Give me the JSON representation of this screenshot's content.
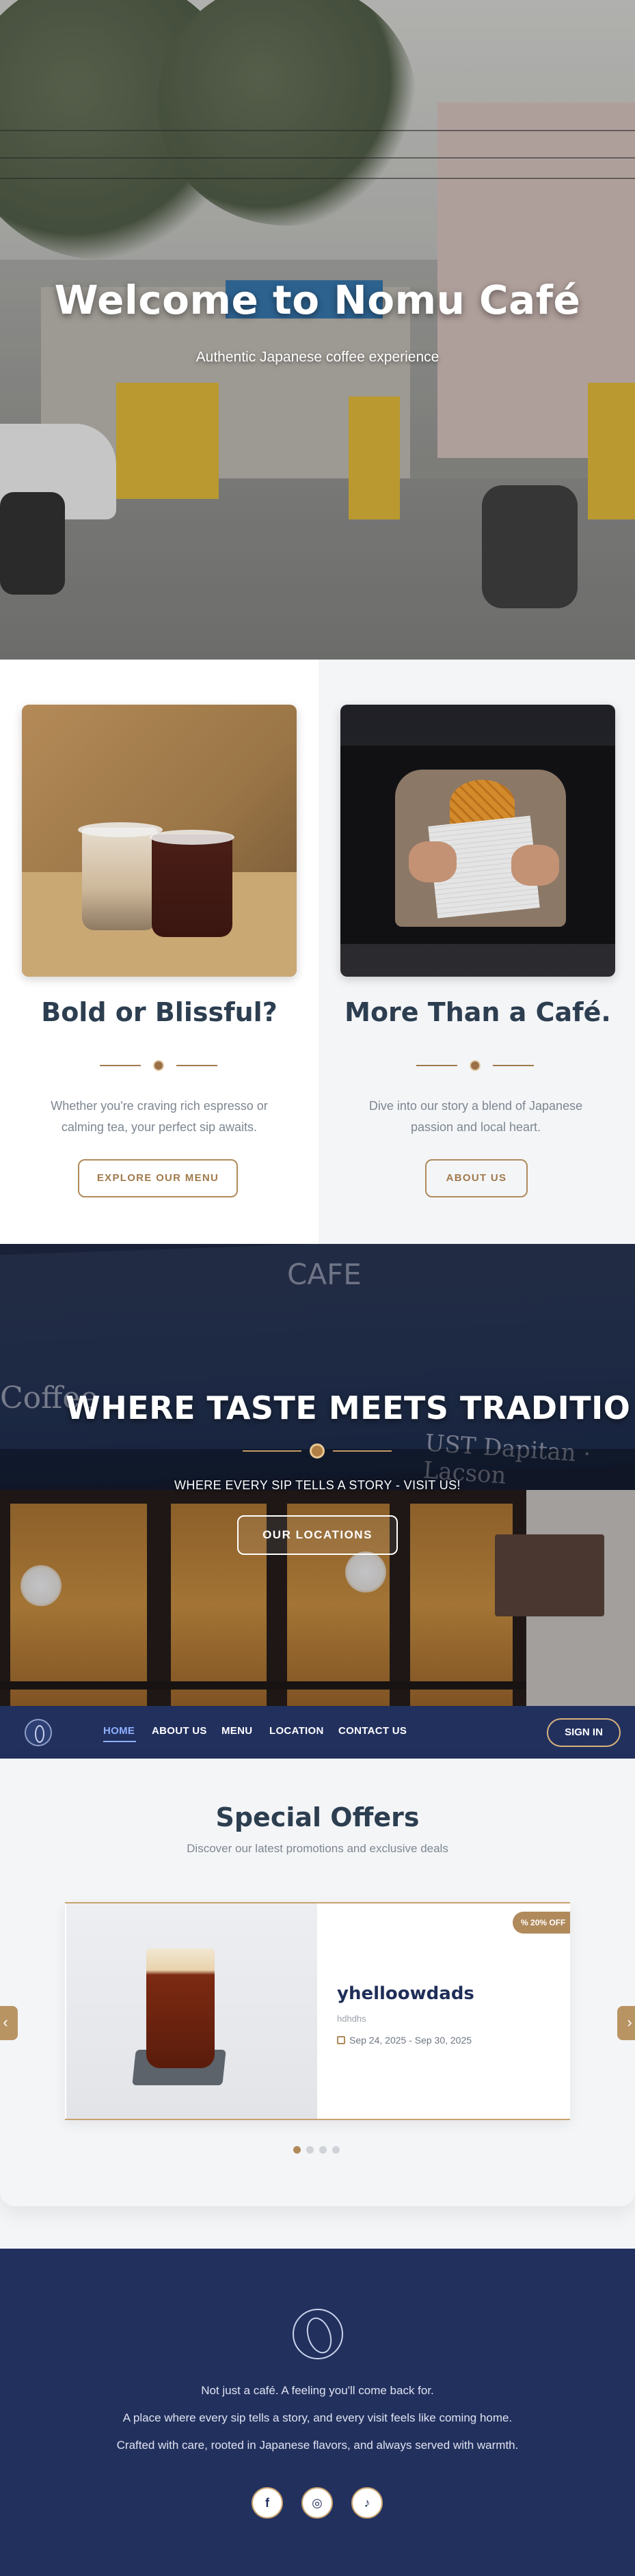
{
  "hero": {
    "title": "Welcome to Nomu Café",
    "subtitle": "Authentic Japanese coffee experience"
  },
  "features": [
    {
      "title": "Bold or Blissful?",
      "text_line1": "Whether you're craving rich espresso or",
      "text_line2": "calming tea, your perfect sip awaits.",
      "button": "EXPLORE OUR MENU"
    },
    {
      "title": "More Than a Café.",
      "text_line1": "Dive into our story a blend of Japanese",
      "text_line2": "passion and local heart.",
      "button": "ABOUT US"
    }
  ],
  "banner": {
    "title": "WHERE TASTE MEETS TRADITIO",
    "subtitle": "WHERE EVERY SIP TELLS A STORY - VISIT US!",
    "button": "OUR LOCATIONS"
  },
  "navbar": {
    "items": [
      "HOME",
      "ABOUT US",
      "MENU",
      "LOCATION",
      "CONTACT US"
    ],
    "active": "HOME",
    "signin": "SIGN IN"
  },
  "offers": {
    "title": "Special Offers",
    "subtitle": "Discover our latest promotions and exclusive deals",
    "card": {
      "title": "yhelloowdads",
      "description": "hdhdhs",
      "dates": "Sep 24, 2025 - Sep 30, 2025",
      "badge": "20% OFF"
    },
    "carousel_dots": 4,
    "active_dot": 1
  },
  "footer": {
    "line1": "Not just a café. A feeling you'll come back for.",
    "line2": "A place where every sip tells a story, and every visit feels like coming home.",
    "line3": "Crafted with care, rooted in Japanese flavors, and always served with warmth.",
    "social": [
      "facebook-icon",
      "instagram-icon",
      "tiktok-icon"
    ]
  },
  "colors": {
    "navy": "#22305e",
    "gold": "#b08a5b",
    "heading": "#2c3e50",
    "muted": "#7d8691"
  }
}
